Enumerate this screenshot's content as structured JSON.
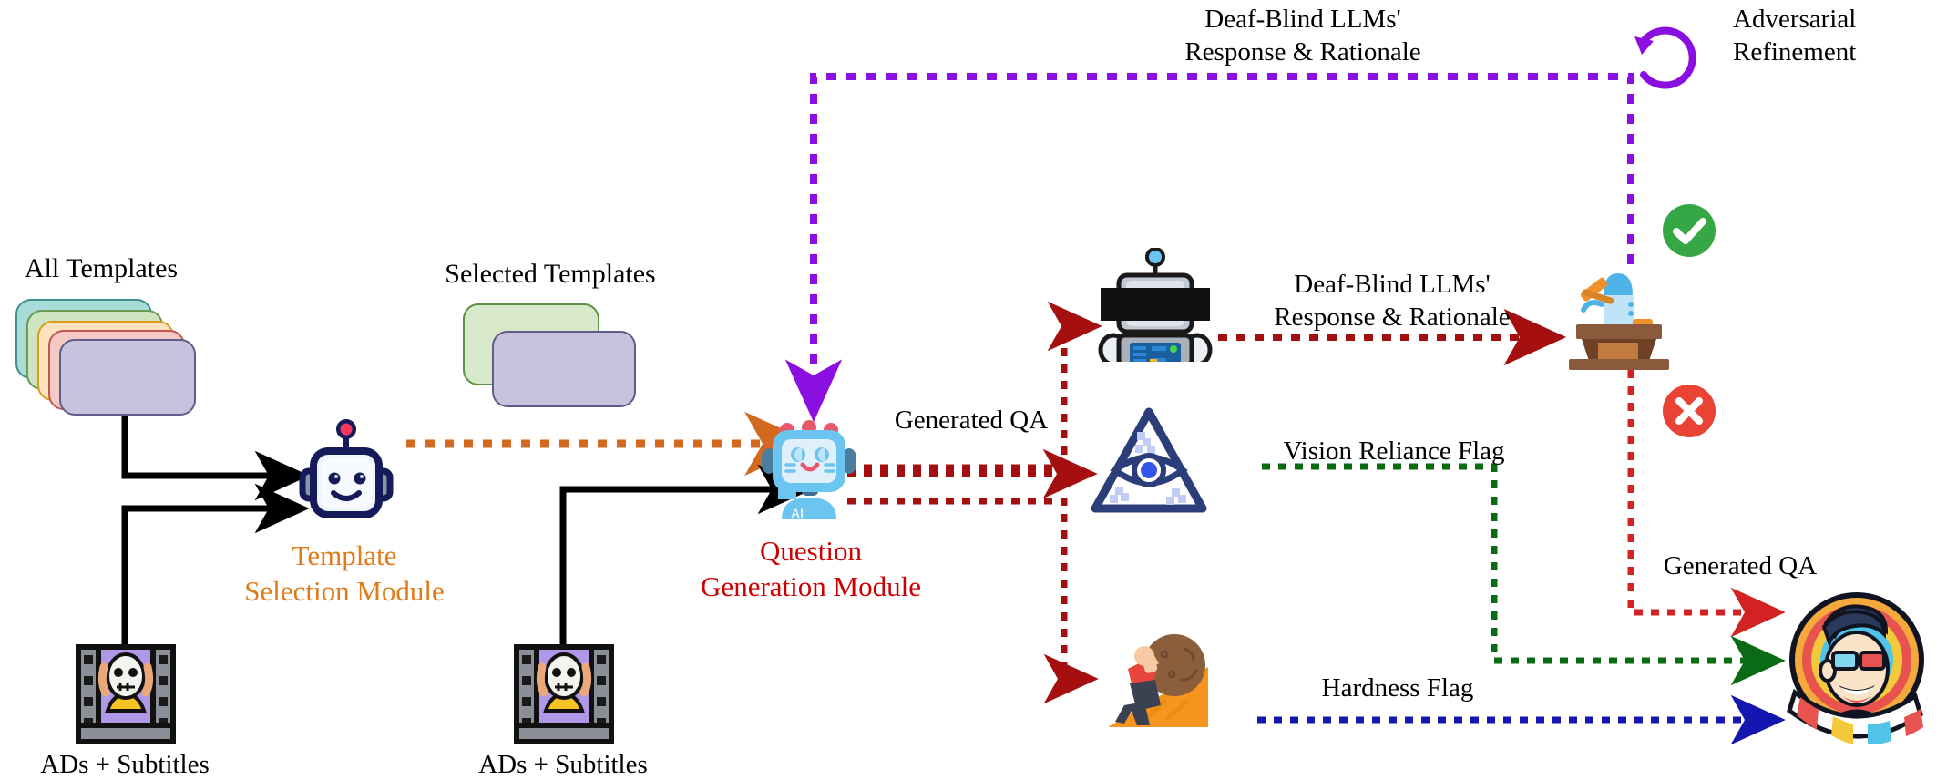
{
  "diagram": {
    "title_flow": "Adversarial QA generation pipeline",
    "background": "#ffffff"
  },
  "labels": {
    "all_templates": "All Templates",
    "selected_templates": "Selected Templates",
    "template_selection_module_l1": "Template",
    "template_selection_module_l2": "Selection Module",
    "question_generation_module_l1": "Question",
    "question_generation_module_l2": "Generation Module",
    "ads_subtitles_left": "ADs + Subtitles",
    "ads_subtitles_right": "ADs + Subtitles",
    "generated_qa_center": "Generated QA",
    "generated_qa_right": "Generated QA",
    "deaf_blind_top_l1": "Deaf-Blind LLMs'",
    "deaf_blind_top_l2": "Response & Rationale",
    "deaf_blind_mid_l1": "Deaf-Blind LLMs'",
    "deaf_blind_mid_l2": "Response & Rationale",
    "adversarial_refinement_l1": "Adversarial",
    "adversarial_refinement_l2": "Refinement",
    "vision_reliance_flag": "Vision Reliance Flag",
    "hardness_flag": "Hardness Flag"
  },
  "colors": {
    "orange": "#d2691e",
    "template_module_text": "#e07b18",
    "question_module_text": "#cc0000",
    "dark_red": "#a50f0f",
    "purple": "#8a0fe0",
    "green": "#0b6b15",
    "blue": "#1515b0",
    "black": "#000000",
    "check_green": "#35a745",
    "cross_red": "#ea4335",
    "navy": "#141b58",
    "robot_blue": "#6cc4f0",
    "template_teal": "#a8dcd9",
    "template_green": "#cfe5c2",
    "template_orange": "#fde2bf",
    "template_red": "#f3c9c6",
    "template_purple": "#c6c4dd"
  },
  "template_stack": {
    "count": 5,
    "cards": [
      {
        "name": "template-card-teal",
        "fill": "#a8dcd9",
        "stroke": "#3f8f8c"
      },
      {
        "name": "template-card-green",
        "fill": "#cfe5c2",
        "stroke": "#6a9a53"
      },
      {
        "name": "template-card-orange",
        "fill": "#fde2bf",
        "stroke": "#dd9a1f"
      },
      {
        "name": "template-card-red",
        "fill": "#f3c9c6",
        "stroke": "#c0564f"
      },
      {
        "name": "template-card-purple",
        "fill": "#c6c4dd",
        "stroke": "#5f5c8a"
      }
    ]
  },
  "selected_stack": {
    "count": 2,
    "cards": [
      {
        "name": "selected-card-green",
        "fill": "#d8e8cb",
        "stroke": "#5e8f45"
      },
      {
        "name": "selected-card-purple",
        "fill": "#c6c4dd",
        "stroke": "#5f5c8a"
      }
    ]
  },
  "icons": {
    "template_robot": "robot-face-icon",
    "question_robot": "ai-robot-icon",
    "blind_llm_robot": "blindfolded-robot-icon",
    "eye_pyramid": "all-seeing-eye-icon",
    "sisyphus": "boulder-push-icon",
    "judge_podium": "judge-podium-icon",
    "check": "check-circle-icon",
    "cross": "cross-circle-icon",
    "refinement_loop": "circular-arrow-icon",
    "film_frame_left": "film-frame-icon",
    "film_frame_right": "film-frame-icon",
    "final_output": "cinema-mascot-icon",
    "ai_badge_text": "AI"
  },
  "edges": [
    {
      "name": "all-templates-to-selector",
      "style": "solid",
      "color": "#000000"
    },
    {
      "name": "left-ads-to-selector",
      "style": "solid",
      "color": "#000000"
    },
    {
      "name": "selector-to-generator",
      "style": "dotted",
      "color": "#d2691e"
    },
    {
      "name": "right-ads-to-generator",
      "style": "solid",
      "color": "#000000"
    },
    {
      "name": "generator-to-blind-llm",
      "style": "dotted",
      "color": "#a50f0f"
    },
    {
      "name": "generator-to-eye",
      "style": "dotted",
      "color": "#a50f0f"
    },
    {
      "name": "generator-to-sisyphus",
      "style": "dotted",
      "color": "#a50f0f"
    },
    {
      "name": "blind-llm-to-judge",
      "style": "dotted",
      "color": "#a50f0f"
    },
    {
      "name": "judge-to-generator-feedback",
      "style": "dotted",
      "color": "#8a0fe0"
    },
    {
      "name": "judge-to-output",
      "style": "dotted",
      "color": "#cc2222"
    },
    {
      "name": "eye-to-output",
      "style": "dotted",
      "color": "#0b6b15"
    },
    {
      "name": "sisyphus-to-output",
      "style": "dotted",
      "color": "#1515b0"
    }
  ]
}
